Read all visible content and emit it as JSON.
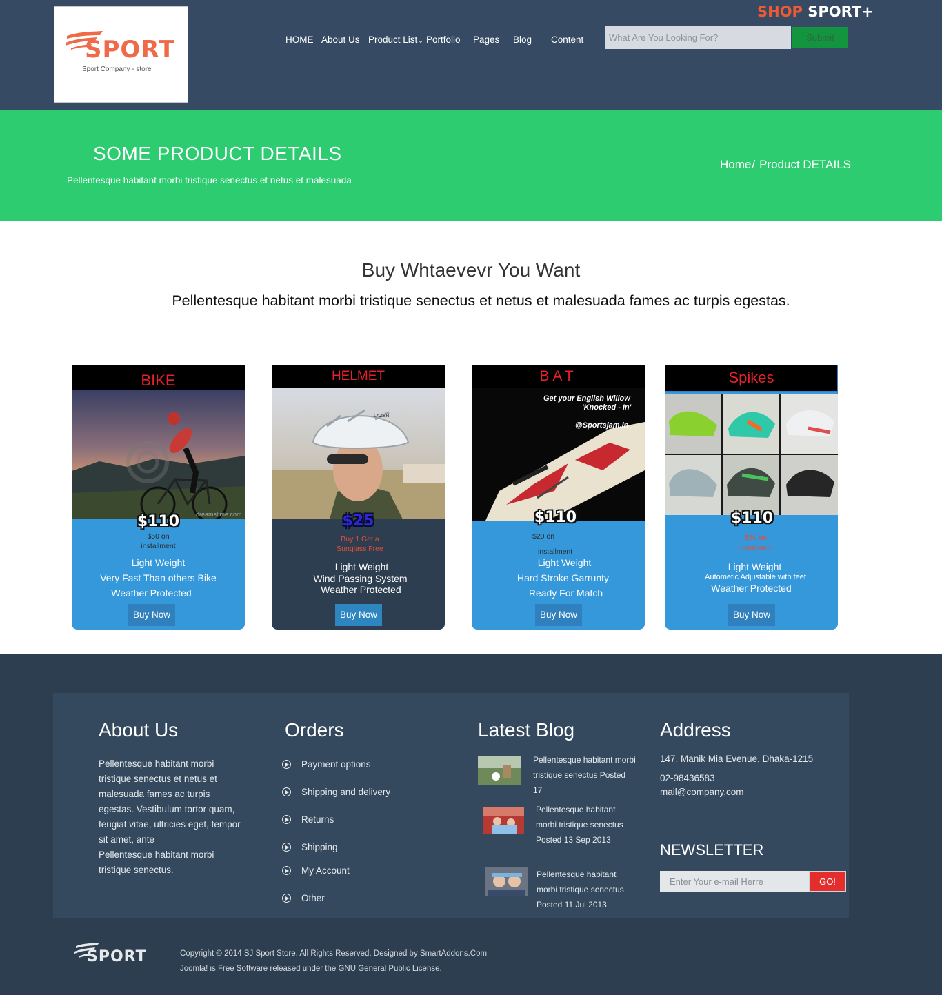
{
  "colors": {
    "header_bg": "#364a63",
    "banner_bg": "#2ecc71",
    "accent_orange": "#ef6a48",
    "card_blue": "#3498db",
    "card_dark": "#2c3e50",
    "footer_bg": "#2c3e50",
    "submit_green": "#13943f",
    "go_red": "#e42d2d"
  },
  "header": {
    "logo_word": "SPORT",
    "logo_tagline": "Sport Company - store",
    "brand_shop": "SHOP",
    "brand_sport": "SPORT+",
    "nav": [
      {
        "label": "HOME"
      },
      {
        "label": "About Us"
      },
      {
        "label": "Product List",
        "caret": "⌄"
      },
      {
        "label": "Portfolio"
      },
      {
        "label": "Pages"
      },
      {
        "label": "Blog"
      },
      {
        "label": "Content"
      }
    ],
    "search_placeholder": "What Are You Looking For?",
    "search_button": "Submit"
  },
  "banner": {
    "title": "SOME PRODUCT DETAILS",
    "subtitle": "Pellentesque habitant morbi tristique senectus et netus et malesuada",
    "breadcrumb_home": "Home",
    "breadcrumb_sep": "/",
    "breadcrumb_current": "Product DETAILS"
  },
  "intro": {
    "title": "Buy Whtaevevr You Want",
    "subtitle": "Pellentesque habitant morbi tristique senectus et netus et malesuada fames ac turpis egestas."
  },
  "products": [
    {
      "name": "BIKE",
      "price": "$110",
      "note_line1": "$50 on",
      "note_line2": "installment",
      "features": [
        "Light Weight",
        "Very Fast Than others Bike",
        "Weather Protected"
      ],
      "button": "Buy Now",
      "image_icon": "cyclist-photo",
      "watermark": "dreamstime.com"
    },
    {
      "name": "HELMET",
      "price": "$25",
      "note_line1": "Buy 1 Get a",
      "note_line2": "Sunglass Free",
      "features": [
        "Light Weight",
        "Wind Passing System",
        "Weather Protected"
      ],
      "button": "Buy Now",
      "image_icon": "helmet-photo",
      "helmet_brand": "LAZER"
    },
    {
      "name": "BAT",
      "price": "$110",
      "note_line1": "$20 on",
      "note_line2": "installment",
      "features": [
        "Light Weight",
        "Hard Stroke Garrunty",
        "Ready For Match"
      ],
      "button": "Buy Now",
      "image_icon": "cricket-bat-photo",
      "image_caption1": "Get your English Willow",
      "image_caption2": "'Knocked - In'",
      "image_handle": "@Sportsjam.in"
    },
    {
      "name": "Spikes",
      "price": "$110",
      "note_line1": "$50 on",
      "note_line2": "installment",
      "features": [
        "Light Weight",
        "Autometic Adjustable with feet",
        "Weather Protected"
      ],
      "button": "Buy Now",
      "image_icon": "spike-shoes-photo"
    }
  ],
  "footer": {
    "about": {
      "title": "About Us",
      "para1": "Pellentesque habitant morbi tristique senectus et netus et malesuada fames ac turpis egestas. Vestibulum tortor quam, feugiat vitae, ultricies eget, tempor sit amet, ante",
      "para2": "Pellentesque habitant morbi tristique senectus."
    },
    "orders": {
      "title": "Orders",
      "links": [
        "Payment options",
        "Shipping and delivery",
        "Returns",
        "Shipping",
        "My Account",
        "Other"
      ]
    },
    "blog": {
      "title": "Latest Blog",
      "posts": [
        {
          "text": "Pellentesque habitant morbi tristique senectus Posted 17"
        },
        {
          "text": "Pellentesque habitant morbi tristique senectus Posted 13 Sep 2013"
        },
        {
          "text": "Pellentesque habitant morbi tristique senectus Posted 11 Jul 2013"
        }
      ]
    },
    "address": {
      "title": "Address",
      "street": "147, Manik Mia Evenue, Dhaka-1215",
      "phone": "02-98436583",
      "email": "mail@company.com"
    },
    "newsletter": {
      "title": "NEWSLETTER",
      "placeholder": "Enter Your e-mail Herre",
      "button": "GO!"
    },
    "bottom_logo": "SPORT",
    "copyright1": "Copyright © 2014 SJ Sport Store. All Rights Reserved. Designed by SmartAddons.Com",
    "copyright2": "Joomla! is Free Software released under the GNU General Public License."
  }
}
